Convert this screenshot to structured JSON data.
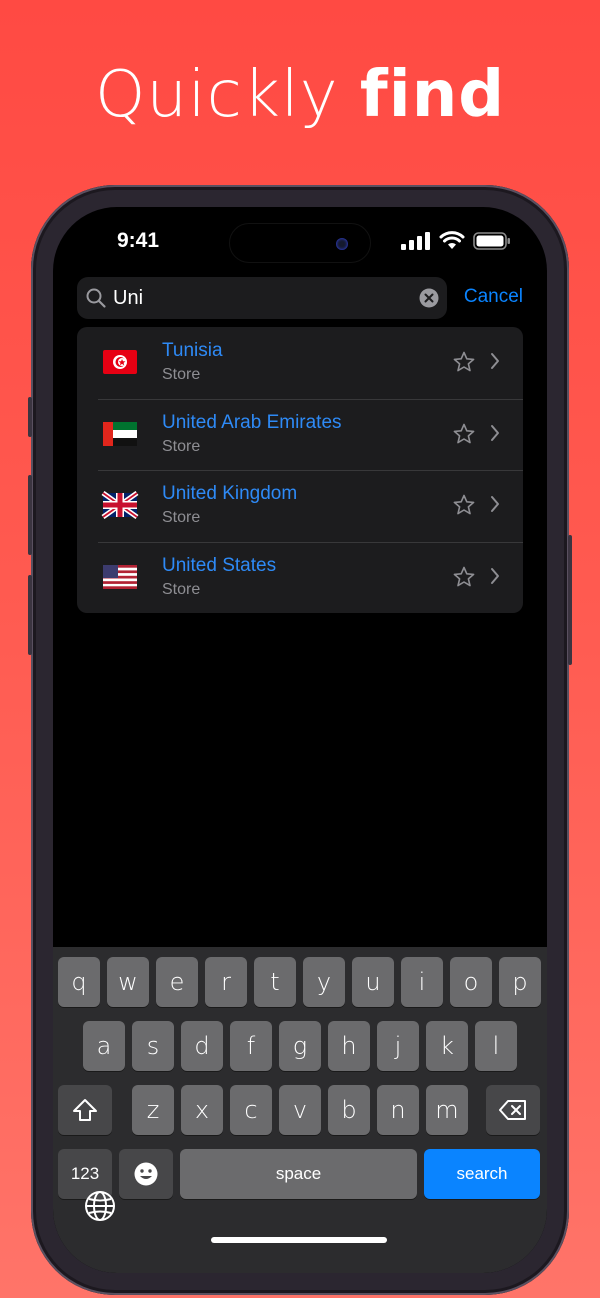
{
  "headline": {
    "light": "Quickly ",
    "bold": "find"
  },
  "status": {
    "time": "9:41"
  },
  "search": {
    "value": "Uni",
    "cancel_label": "Cancel"
  },
  "results": [
    {
      "name": "Tunisia",
      "subtitle": "Store",
      "flag": "tunisia-flag"
    },
    {
      "name": "United Arab Emirates",
      "subtitle": "Store",
      "flag": "uae-flag"
    },
    {
      "name": "United Kingdom",
      "subtitle": "Store",
      "flag": "uk-flag"
    },
    {
      "name": "United States",
      "subtitle": "Store",
      "flag": "us-flag"
    }
  ],
  "keyboard": {
    "row1": [
      "q",
      "w",
      "e",
      "r",
      "t",
      "y",
      "u",
      "i",
      "o",
      "p"
    ],
    "row2": [
      "a",
      "s",
      "d",
      "f",
      "g",
      "h",
      "j",
      "k",
      "l"
    ],
    "row3": [
      "z",
      "x",
      "c",
      "v",
      "b",
      "n",
      "m"
    ],
    "numbers_label": "123",
    "space_label": "space",
    "search_label": "search"
  },
  "colors": {
    "accent": "#0a84ff",
    "link": "#2e8af6",
    "background": "#ff4a43"
  }
}
